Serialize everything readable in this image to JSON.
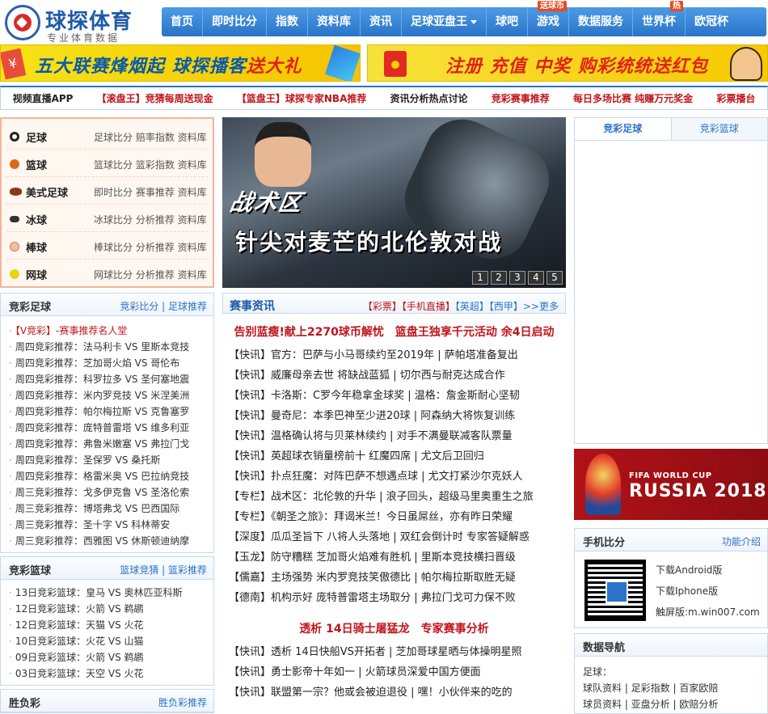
{
  "header": {
    "logo_name": "球探体育",
    "logo_sub": "专业体育数据",
    "nav": [
      {
        "label": "首页",
        "badge": ""
      },
      {
        "label": "即时比分",
        "badge": ""
      },
      {
        "label": "指数",
        "badge": ""
      },
      {
        "label": "资料库",
        "badge": ""
      },
      {
        "label": "资讯",
        "badge": ""
      },
      {
        "label": "足球亚盘王",
        "badge": ""
      },
      {
        "label": "球吧",
        "badge": ""
      },
      {
        "label": "游戏",
        "badge": "送球币"
      },
      {
        "label": "数据服务",
        "badge": ""
      },
      {
        "label": "世界杯",
        "badge": "热"
      },
      {
        "label": "欧冠杯",
        "badge": ""
      }
    ]
  },
  "banners": {
    "left_a": "五大联赛烽烟起",
    "left_b": "球探播客",
    "left_c": "送大礼",
    "right": "注册 充值 中奖 购彩统统送红包"
  },
  "quicklinks": [
    "视频直播APP",
    "【滚盘王】竞猜每周送现金",
    "【篮盘王】球探专家NBA推荐",
    "资讯分析热点讨论",
    "竞彩赛事推荐",
    "每日多场比赛 纯赚万元奖金",
    "彩票播台"
  ],
  "sports": [
    {
      "name": "足球",
      "links": "足球比分 赔率指数 资料库",
      "color": "#222222"
    },
    {
      "name": "篮球",
      "links": "篮球比分 篮彩指数 资料库",
      "color": "#e0661a"
    },
    {
      "name": "美式足球",
      "links": "即时比分 赛事推荐 资料库",
      "color": "#8a3a1a"
    },
    {
      "name": "冰球",
      "links": "冰球比分 分析推荐 资料库",
      "color": "#333333"
    },
    {
      "name": "棒球",
      "links": "棒球比分 分析推荐 资料库",
      "color": "#f0c0a0"
    },
    {
      "name": "网球",
      "links": "网球比分 分析推荐 资料库",
      "color": "#e8d21a"
    }
  ],
  "hero": {
    "tag": "战术区",
    "title": "针尖对麦芒的北伦敦对战",
    "pages": [
      "1",
      "2",
      "3",
      "4",
      "5"
    ]
  },
  "right_tabs": [
    "竞彩足球",
    "竞彩篮球"
  ],
  "russia": {
    "line1": "FIFA WORLD CUP",
    "line2": "RUSSIA 2018"
  },
  "jczq": {
    "title": "竞彩足球",
    "more": "竞彩比分 | 足球推荐",
    "items": [
      "【V竞彩】-赛事推荐名人堂",
      "周四竞彩推荐：法马利卡 VS 里斯本竞技",
      "周四竞彩推荐：芝加哥火焰 VS 哥伦布",
      "周四竞彩推荐：科罗拉多 VS 圣何塞地震",
      "周四竞彩推荐：米内罗竞技 VS 米涅美洲",
      "周四竞彩推荐：帕尔梅拉斯 VS 克鲁塞罗",
      "周四竞彩推荐：庞特普雷塔 VS 维多利亚",
      "周四竞彩推荐：弗鲁米嫩塞 VS 弗拉门戈",
      "周四竞彩推荐：圣保罗 VS 桑托斯",
      "周四竞彩推荐：格雷米奥 VS 巴拉纳竞技",
      "周三竞彩推荐：戈多伊克鲁 VS 圣洛伦索",
      "周三竞彩推荐：博塔弗戈 VS 巴西国际",
      "周三竞彩推荐：圣十字 VS 科林蒂安",
      "周三竞彩推荐：西雅图 VS 休斯顿迪纳摩"
    ]
  },
  "jclq": {
    "title": "竞彩篮球",
    "more": "篮球竞猜 | 篮彩推荐",
    "items": [
      "13日竞彩篮球：皇马 VS 奥林匹亚科斯",
      "12日竞彩篮球：火箭 VS 鹈鹕",
      "12日竞彩篮球：天猫 VS 火花",
      "10日竞彩篮球：火花 VS 山猫",
      "09日竞彩篮球：火箭 VS 鹈鹕",
      "03日竞彩篮球：天空 VS 火花"
    ]
  },
  "bottom_left": {
    "title": "胜负彩",
    "more": "胜负彩推荐"
  },
  "news": {
    "title": "赛事资讯",
    "tags_red": "【彩票】【手机直播】",
    "tags_blue": "【英超】【西甲】>>更多",
    "headline1": "告别蓝瘦!献上2270球币解忧　篮盘王独享千元活动 余4日启动",
    "items1": [
      {
        "k": "【快讯】",
        "t": "官方：巴萨与小马哥续约至2019年 | 萨帕塔准备复出"
      },
      {
        "k": "【快讯】",
        "t": "威廉母亲去世 将缺战蓝狐 | 切尔西与耐克达成合作"
      },
      {
        "k": "【快讯】",
        "t": "卡洛斯：C罗今年稳拿金球奖 | 温格：詹金斯耐心坚韧"
      },
      {
        "k": "【快讯】",
        "t": "曼奇尼：本季巴神至少进20球 | 阿森纳大将恢复训练"
      },
      {
        "k": "【快讯】",
        "t": "温格确认将与贝莱林续约 | 对手不满曼联减客队票量"
      },
      {
        "k": "【快讯】",
        "t": "英超球衣销量榜前十 红魔四席 | 尤文后卫回归"
      },
      {
        "k": "【快讯】",
        "t": "扑点狂魔：对阵巴萨不想遇点球 | 尤文打紧沙尔克妖人"
      },
      {
        "k": "【专栏】",
        "t": "战术区：北伦敦的升华 | 浪子回头，超级马里奥重生之旅"
      },
      {
        "k": "【专栏】",
        "t": "《朝圣之旅》：拜谒米兰！今日虽屌丝，亦有昨日荣耀"
      },
      {
        "k": "【深度】",
        "t": "瓜瓜圣旨下 八将人头落地 | 双红会倒计时 专家答疑解惑"
      },
      {
        "k": "【玉龙】",
        "t": "防守糟糕 芝加哥火焰难有胜机 | 里斯本竞技横扫晋级"
      },
      {
        "k": "【儒嘉】",
        "t": "主场强势 米内罗竞技笑傲德比 | 帕尔梅拉斯取胜无疑"
      },
      {
        "k": "【德南】",
        "t": "机构示好 庞特普雷塔主场取分 | 弗拉门戈可力保不败"
      }
    ],
    "headline2": "透析 14日骑士屠猛龙　专家赛事分析",
    "items2": [
      {
        "k": "【快讯】",
        "t": "透析 14日快船VS开拓者 | 芝加哥球星晒与体操明星照"
      },
      {
        "k": "【快讯】",
        "t": "勇士影帝十年如一 | 火箭球员深爱中国方便面"
      },
      {
        "k": "【快讯】",
        "t": "联盟第一宗？他或会被迫退役 | 嘿！小伙伴来的吃的"
      }
    ]
  },
  "mobile": {
    "title": "手机比分",
    "more": "功能介绍",
    "android": "下载Android版",
    "iphone": "下载Iphone版",
    "touch": "触屏版:m.win007.com"
  },
  "datanav": {
    "title": "数据导航",
    "label": "足球：",
    "row1": "球队资料 | 足彩指数 | 百家欧赔",
    "row2": "球员资料 | 亚盘分析 | 欧赔分析"
  }
}
